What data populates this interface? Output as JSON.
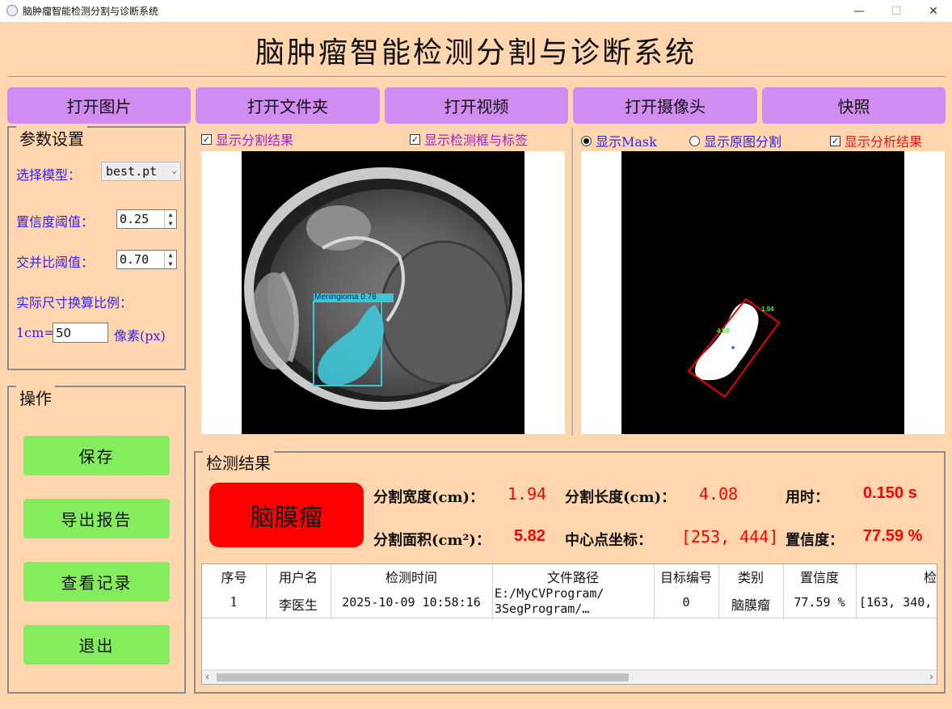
{
  "window": {
    "title": "脑肿瘤智能检测分割与诊断系统",
    "controls": {
      "minimize": "—",
      "maximize": "☐",
      "close": "✕"
    }
  },
  "header": {
    "title": "脑肿瘤智能检测分割与诊断系统"
  },
  "toolbar": {
    "open_image": "打开图片",
    "open_folder": "打开文件夹",
    "open_video": "打开视频",
    "open_camera": "打开摄像头",
    "snapshot": "快照"
  },
  "params": {
    "title": "参数设置",
    "model_label": "选择模型：",
    "model_value": "best.pt",
    "conf_label": "置信度阈值：",
    "conf_value": "0.25",
    "iou_label": "交并比阈值：",
    "iou_value": "0.70",
    "scale_label": "实际尺寸换算比例：",
    "scale_prefix": "1cm=",
    "scale_value": "50",
    "scale_unit": "像素(px)"
  },
  "operations": {
    "title": "操作",
    "save": "保存",
    "export": "导出报告",
    "records": "查看记录",
    "exit": "退出"
  },
  "left_view": {
    "show_seg": "显示分割结果",
    "show_box": "显示检测框与标签",
    "box_label": "Meningioma 0.78"
  },
  "right_view": {
    "show_mask": "显示Mask",
    "show_orig_seg": "显示原图分割",
    "show_analysis": "显示分析结果",
    "width_annot": "1.94",
    "length_annot": "4.08"
  },
  "results": {
    "title": "检测结果",
    "diagnosis": "脑膜瘤",
    "seg_width_label": "分割宽度(cm)：",
    "seg_width_value": "1.94",
    "seg_length_label": "分割长度(cm)：",
    "seg_length_value": "4.08",
    "time_label": "用时：",
    "time_value": "0.150 s",
    "area_label": "分割面积(cm²)：",
    "area_value": "5.82",
    "center_label": "中心点坐标：",
    "center_value": "[253, 444]",
    "conf_label": "置信度：",
    "conf_value": "77.59 %"
  },
  "table": {
    "headers": [
      "序号",
      "用户名",
      "检测时间",
      "文件路径",
      "目标编号",
      "类别",
      "置信度",
      "检测"
    ],
    "rows": [
      {
        "index": "1",
        "user": "李医生",
        "time": "2025-10-09 10:58:16",
        "path_line1": "E:/MyCVProgram/",
        "path_line2": "3SegProgram/…",
        "target_id": "0",
        "category": "脑膜瘤",
        "confidence": "77.59 %",
        "box": "[163, 340,"
      }
    ]
  },
  "colors": {
    "background": "#FFD6AE",
    "toolbar_button": "#D18CF2",
    "action_button": "#84ED5D",
    "diagnosis_badge": "#FF0000",
    "value_red": "#FF0000",
    "label_blue": "#3322EE",
    "segmentation": "#3FC6D6",
    "bbox_red": "#EE0000",
    "annotation_green": "#33FF33"
  }
}
